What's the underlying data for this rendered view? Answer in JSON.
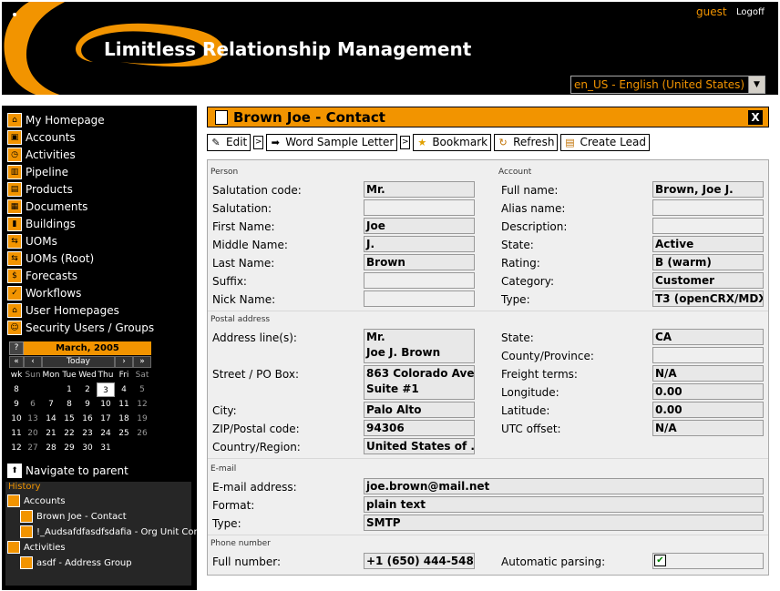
{
  "header": {
    "app_title": "Limitless Relationship Management",
    "user": "guest",
    "logoff": "Logoff",
    "locale": "en_US - English (United States)"
  },
  "sidebar": {
    "items": [
      {
        "label": "My Homepage",
        "icon": "home-icon"
      },
      {
        "label": "Accounts",
        "icon": "accounts-icon"
      },
      {
        "label": "Activities",
        "icon": "activities-icon"
      },
      {
        "label": "Pipeline",
        "icon": "pipeline-icon"
      },
      {
        "label": "Products",
        "icon": "products-icon"
      },
      {
        "label": "Documents",
        "icon": "documents-icon"
      },
      {
        "label": "Buildings",
        "icon": "buildings-icon"
      },
      {
        "label": "UOMs",
        "icon": "uoms-icon"
      },
      {
        "label": "UOMs (Root)",
        "icon": "uoms-root-icon"
      },
      {
        "label": "Forecasts",
        "icon": "forecasts-icon"
      },
      {
        "label": "Workflows",
        "icon": "workflows-icon"
      },
      {
        "label": "User Homepages",
        "icon": "user-homepages-icon"
      },
      {
        "label": "Security Users / Groups",
        "icon": "security-icon"
      }
    ],
    "navigate_parent": "Navigate to parent",
    "history": {
      "title": "History",
      "items": [
        {
          "label": "Accounts"
        },
        {
          "label": "Brown Joe - Contact"
        },
        {
          "label": "!_Audsafdfasdfsdafia - Org Unit Con"
        },
        {
          "label": "Activities"
        },
        {
          "label": "asdf - Address Group"
        }
      ]
    }
  },
  "calendar": {
    "help": "?",
    "title": "March, 2005",
    "nav": [
      "«",
      "‹",
      "Today",
      "›",
      "»"
    ],
    "weekdays": [
      "wk",
      "Sun",
      "Mon",
      "Tue",
      "Wed",
      "Thu",
      "Fri",
      "Sat"
    ],
    "weeks": [
      [
        "8",
        "",
        "",
        "1",
        "2",
        "3",
        "4",
        "5"
      ],
      [
        "9",
        "6",
        "7",
        "8",
        "9",
        "10",
        "11",
        "12"
      ],
      [
        "10",
        "13",
        "14",
        "15",
        "16",
        "17",
        "18",
        "19"
      ],
      [
        "11",
        "20",
        "21",
        "22",
        "23",
        "24",
        "25",
        "26"
      ],
      [
        "12",
        "27",
        "28",
        "29",
        "30",
        "31",
        "",
        ""
      ]
    ],
    "today": "3"
  },
  "main": {
    "title": "Brown Joe - Contact",
    "close": "X",
    "toolbar": {
      "edit": "Edit",
      "word": "Word Sample Letter",
      "bookmark": "Bookmark",
      "refresh": "Refresh",
      "create_lead": "Create Lead",
      "sep": ">"
    },
    "person": {
      "section": "Person",
      "fields": [
        {
          "label": "Salutation code:",
          "value": "Mr."
        },
        {
          "label": "Salutation:",
          "value": ""
        },
        {
          "label": "First Name:",
          "value": "Joe"
        },
        {
          "label": "Middle Name:",
          "value": "J."
        },
        {
          "label": "Last Name:",
          "value": "Brown"
        },
        {
          "label": "Suffix:",
          "value": ""
        },
        {
          "label": "Nick Name:",
          "value": ""
        }
      ]
    },
    "account": {
      "section": "Account",
      "fields": [
        {
          "label": "Full name:",
          "value": "Brown, Joe J."
        },
        {
          "label": "Alias name:",
          "value": ""
        },
        {
          "label": "Description:",
          "value": ""
        },
        {
          "label": "State:",
          "value": "Active"
        },
        {
          "label": "Rating:",
          "value": "B (warm)"
        },
        {
          "label": "Category:",
          "value": "Customer"
        },
        {
          "label": "Type:",
          "value": "T3 (openCRX/MDX)"
        }
      ]
    },
    "postal": {
      "section": "Postal address",
      "address_label": "Address line(s):",
      "address_lines": [
        "Mr.",
        "Joe J. Brown"
      ],
      "street_label": "Street / PO Box:",
      "street_lines": [
        "863 Colorado Ave",
        "Suite #1"
      ],
      "city_label": "City:",
      "city": "Palo Alto",
      "zip_label": "ZIP/Postal code:",
      "zip": "94306",
      "country_label": "Country/Region:",
      "country": "United States of ...",
      "state_label": "State:",
      "state": "CA",
      "county_label": "County/Province:",
      "county": "",
      "freight_label": "Freight terms:",
      "freight": "N/A",
      "longitude_label": "Longitude:",
      "longitude": "0.00",
      "latitude_label": "Latitude:",
      "latitude": "0.00",
      "utc_label": "UTC offset:",
      "utc": "N/A"
    },
    "email": {
      "section": "E-mail",
      "address_label": "E-mail address:",
      "address": "joe.brown@mail.net",
      "format_label": "Format:",
      "format": "plain text",
      "type_label": "Type:",
      "type": "SMTP"
    },
    "phone": {
      "section": "Phone number",
      "full_label": "Full number:",
      "full": "+1 (650) 444-5486",
      "parsing_label": "Automatic parsing:",
      "parsing_checked": true
    }
  },
  "colors": {
    "accent": "#f29400",
    "background": "#000000"
  }
}
